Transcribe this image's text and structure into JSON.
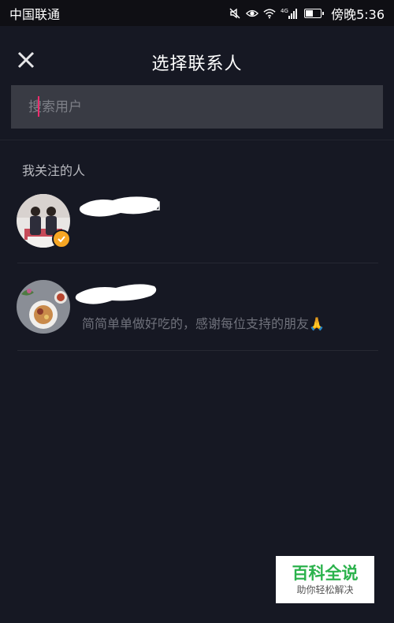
{
  "status_bar": {
    "carrier": "中国联通",
    "time": "傍晚5:36",
    "network": "4G",
    "icons": [
      "mute-icon",
      "eye-icon",
      "wifi-icon",
      "signal-icon",
      "battery-icon"
    ]
  },
  "header": {
    "title": "选择联系人",
    "close_icon": "close-icon"
  },
  "search": {
    "placeholder": "搜索用户",
    "value": ""
  },
  "section": {
    "label": "我关注的人"
  },
  "users": [
    {
      "name": "",
      "description": "",
      "verified": true
    },
    {
      "name": "",
      "description": "简简单单做好吃的，感谢每位支持的朋友🙏",
      "verified": false
    }
  ],
  "watermark": {
    "title": "百科全说",
    "subtitle": "助你轻松解决"
  },
  "colors": {
    "background": "#161823",
    "search_bg": "#393b44",
    "cursor": "#ee2c6d",
    "verified": "#f7a623",
    "watermark_green": "#2bb24c"
  }
}
